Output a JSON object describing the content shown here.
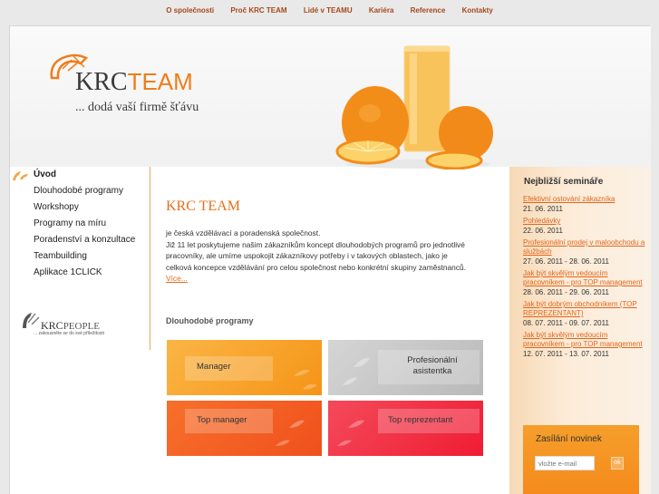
{
  "topnav": {
    "items": [
      "O společnosti",
      "Proč KRC TEAM",
      "Lidé v TEAMU",
      "Kariéra",
      "Reference",
      "Kontakty"
    ]
  },
  "header": {
    "logo_krc": "KRC",
    "logo_team": "TEAM",
    "tagline": "... dodá vaší firmě šťávu"
  },
  "sidebar": {
    "items": [
      {
        "label": "Úvod",
        "active": true
      },
      {
        "label": "Dlouhodobé programy"
      },
      {
        "label": "Workshopy"
      },
      {
        "label": "Programy na míru"
      },
      {
        "label": "Poradenství a konzultace"
      },
      {
        "label": "Teambuilding"
      },
      {
        "label": "Aplikace 1CLICK"
      }
    ],
    "partner": {
      "krc": "KRC",
      "people": "PEOPLE",
      "subtitle": "... zakousněte se do své příležitosti"
    }
  },
  "main": {
    "title": "KRC TEAM",
    "intro_lines": [
      "je česká vzdělávací a poradenská společnost.",
      "Již 11 let poskytujeme našim zákazníkům koncept dlouhodobých programů pro jednotlivé",
      "pracovníky, ale umíme uspokojit zákazníkovy potřeby i v takových oblastech, jako je",
      "celková koncepce vzdělávání pro celou společnost nebo konkrétní skupiny zaměstnanců."
    ],
    "more_label": "Více...",
    "programs_title": "Dlouhodobé programy",
    "tiles": [
      "Manager",
      "Profesionální asistentka",
      "Top manager",
      "Top reprezentant"
    ]
  },
  "right": {
    "title": "Nejbližší semináře",
    "seminars": [
      {
        "title": "Efektivní ostování zákazníka",
        "date": "21. 06. 2011"
      },
      {
        "title": "Pohledávky",
        "date": "22. 06. 2011"
      },
      {
        "title": "Profesionální prodej v maloobchodu a službách",
        "date": "27. 06. 2011 - 28. 06. 2011"
      },
      {
        "title": "Jak být skvělým vedoucím pracovníkem - pro TOP management",
        "date": "28. 06. 2011 - 29. 06. 2011"
      },
      {
        "title": "Jak být dobrým obchodníkem (TOP REPREZENTANT)",
        "date": "08. 07. 2011 - 09. 07. 2011"
      },
      {
        "title": "Jak být skvělým vedoucím pracovníkem - pro TOP management",
        "date": "12. 07. 2011 - 13. 07. 2011"
      }
    ],
    "newsletter": {
      "title": "Zasílání novinek",
      "placeholder": "vložte e-mail",
      "button": "ok"
    }
  },
  "colors": {
    "accent": "#ef7d1a",
    "link": "#e3651a",
    "tile_manager": "#f8a12b",
    "tile_assistant": "#c8c8c8",
    "tile_top_manager": "#f25f22",
    "tile_top_rep": "#f02d45"
  }
}
